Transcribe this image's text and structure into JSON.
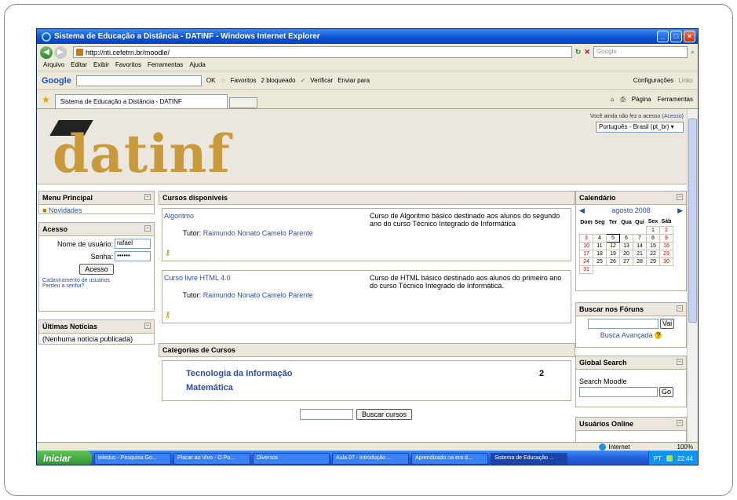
{
  "window": {
    "title": "Sistema de Educação a Distância - DATINF - Windows Internet Explorer"
  },
  "address": {
    "url": "http://nti.cefetrn.br/moodle/",
    "search_placeholder": "Google"
  },
  "menu": [
    "Arquivo",
    "Editar",
    "Exibir",
    "Favoritos",
    "Ferramentas",
    "Ajuda"
  ],
  "google_toolbar": {
    "logo_g": "Google",
    "go": "OK",
    "favoritos": "Favoritos",
    "blocked": "2 bloqueado",
    "verificar": "Verificar",
    "enviar": "Enviar para",
    "config": "Configurações",
    "links": "Links"
  },
  "tab": {
    "title": "Sistema de Educação a Distância - DATINF",
    "page": "Página",
    "tools": "Ferramentas"
  },
  "header": {
    "logo": "datinf",
    "login_note_prefix": "Você ainda não fez o acesso",
    "login_note_link": "Acesso",
    "language": "Português - Brasil (pt_br)"
  },
  "menu_principal": {
    "title": "Menu Principal",
    "item": "Novidades"
  },
  "acesso": {
    "title": "Acesso",
    "user_label": "Nome de usuário:",
    "user_value": "rafael",
    "pass_label": "Senha:",
    "pass_value": "••••••",
    "button": "Acesso",
    "signup": "Cadastramento de usuários",
    "forgot": "Perdeu a senha?"
  },
  "noticias": {
    "title": "Últimas Notícias",
    "empty": "(Nenhuma notícia publicada)"
  },
  "cursos": {
    "title": "Cursos disponíveis",
    "items": [
      {
        "name": "Algoritmo",
        "tutor_label": "Tutor:",
        "tutor": "Raimundo Nonato Camelo Parente",
        "desc": "Curso de Algoritmo básico destinado aos alunos do segundo ano do curso Técnico Integrado de Informática"
      },
      {
        "name": "Curso livre HTML 4.0",
        "tutor_label": "Tutor:",
        "tutor": "Raimundo Nonato Camelo Parente",
        "desc": "Curso de HTML básico destinado aos alunos do primeiro ano do curso Técnico Integrado de Informática."
      }
    ]
  },
  "categorias": {
    "title": "Categorias de Cursos",
    "items": [
      {
        "name": "Tecnologia da Informação",
        "count": "2"
      },
      {
        "name": "Matemática",
        "count": ""
      }
    ],
    "search_button": "Buscar cursos"
  },
  "calendario": {
    "title": "Calendário",
    "month": "agosto 2008",
    "days": [
      "Dom",
      "Seg",
      "Ter",
      "Qua",
      "Qui",
      "Sex",
      "Sáb"
    ],
    "weeks": [
      [
        "",
        "",
        "",
        "",
        "",
        "1",
        "2"
      ],
      [
        "3",
        "4",
        "5",
        "6",
        "7",
        "8",
        "9"
      ],
      [
        "10",
        "11",
        "12",
        "13",
        "14",
        "15",
        "16"
      ],
      [
        "17",
        "18",
        "19",
        "20",
        "21",
        "22",
        "23"
      ],
      [
        "24",
        "25",
        "26",
        "27",
        "28",
        "29",
        "30"
      ],
      [
        "31",
        "",
        "",
        "",
        "",
        "",
        ""
      ]
    ],
    "today": "5"
  },
  "forum": {
    "title": "Buscar nos Fóruns",
    "go": "Vai",
    "advanced": "Busca Avançada"
  },
  "global_search": {
    "title": "Global Search",
    "label": "Search Moodle",
    "go": "Go"
  },
  "usuarios": {
    "title": "Usuários Online"
  },
  "status": {
    "zone": "Internet",
    "zoom": "100%"
  },
  "taskbar": {
    "start": "Iniciar",
    "tasks": [
      "teleduc - Pesquisa Go...",
      "Placar ao Vivo - O Po...",
      "Diversos",
      "Aula 07 - Introdução ...",
      "Aprendizado na era d...",
      "Sistema de Educação ..."
    ],
    "lang": "PT",
    "time": "22:44"
  }
}
